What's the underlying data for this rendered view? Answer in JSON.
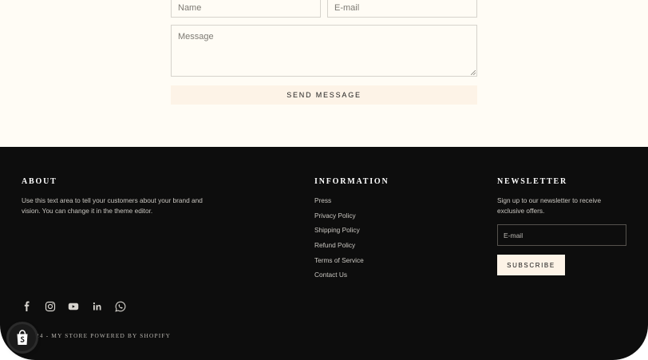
{
  "contact_form": {
    "name_placeholder": "Name",
    "email_placeholder": "E-mail",
    "message_placeholder": "Message",
    "send_label": "SEND MESSAGE"
  },
  "footer": {
    "about": {
      "title": "ABOUT",
      "text": "Use this text area to tell your customers about your brand and vision. You can change it in the theme editor."
    },
    "information": {
      "title": "INFORMATION",
      "links": [
        "Press",
        "Privacy Policy",
        "Shipping Policy",
        "Refund Policy",
        "Terms of Service",
        "Contact Us"
      ]
    },
    "newsletter": {
      "title": "NEWSLETTER",
      "text": "Sign up to our newsletter to receive exclusive offers.",
      "email_placeholder": "E-mail",
      "subscribe_label": "SUBSCRIBE"
    },
    "social_icons": [
      "facebook-icon",
      "instagram-icon",
      "youtube-icon",
      "linkedin-icon",
      "whatsapp-icon"
    ],
    "copyright": "24 - MY STORE POWERED BY SHOPIFY"
  },
  "colors": {
    "form_background": "#fffcf5",
    "footer_background": "#0d0d0d",
    "button_background": "#fdf3e7",
    "footer_text": "#c9c6c0"
  }
}
